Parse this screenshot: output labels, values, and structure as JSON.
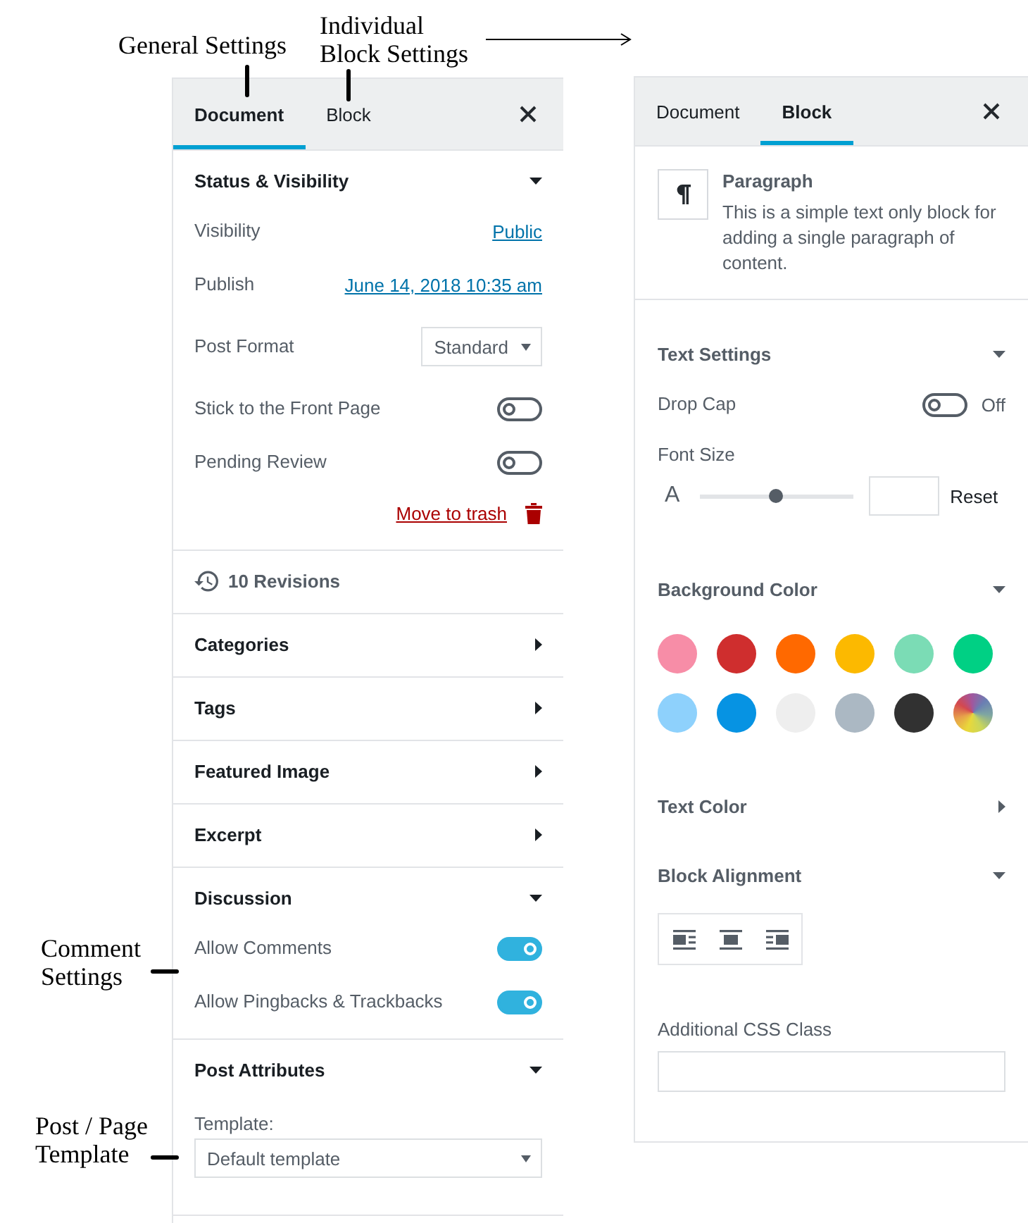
{
  "annotations": [
    {
      "kind": "down",
      "text": "General Settings"
    },
    {
      "kind": "down",
      "text": "Individual Block Settings"
    },
    {
      "kind": "arrow"
    },
    {
      "kind": "side",
      "text": "Comment Settings"
    },
    {
      "kind": "side",
      "text": "Post / Page Template"
    }
  ],
  "document_panel": {
    "tabs": [
      {
        "label": "Document",
        "selected": true
      },
      {
        "label": "Block",
        "selected": false
      }
    ],
    "sections": [
      {
        "kind": "panel",
        "title": "Status & Visibility",
        "expanded": true,
        "rows": [
          {
            "kind": "link",
            "label": "Visibility",
            "value": "Public"
          },
          {
            "kind": "link",
            "label": "Publish",
            "value": "June 14, 2018 10:35 am"
          },
          {
            "kind": "select",
            "label": "Post Format",
            "value": "Standard"
          },
          {
            "kind": "toggle",
            "label": "Stick to the Front Page",
            "on": false
          },
          {
            "kind": "toggle",
            "label": "Pending Review",
            "on": false
          },
          {
            "kind": "trash",
            "label": "Move to trash"
          }
        ]
      },
      {
        "kind": "revisions",
        "title": "10 Revisions"
      },
      {
        "kind": "panel",
        "title": "Categories",
        "expanded": false
      },
      {
        "kind": "panel",
        "title": "Tags",
        "expanded": false
      },
      {
        "kind": "panel",
        "title": "Featured Image",
        "expanded": false
      },
      {
        "kind": "panel",
        "title": "Excerpt",
        "expanded": false
      },
      {
        "kind": "panel",
        "title": "Discussion",
        "expanded": true,
        "rows": [
          {
            "kind": "toggle",
            "label": "Allow Comments",
            "on": true
          },
          {
            "kind": "toggle",
            "label": "Allow Pingbacks & Trackbacks",
            "on": true
          }
        ]
      },
      {
        "kind": "panel",
        "title": "Post Attributes",
        "expanded": true,
        "rows": [
          {
            "kind": "select_block",
            "label": "Template:",
            "value": "Default template"
          }
        ]
      }
    ]
  },
  "block_panel": {
    "tabs": [
      {
        "label": "Document",
        "selected": false
      },
      {
        "label": "Block",
        "selected": true
      }
    ],
    "block_card": {
      "title": "Paragraph",
      "description": "This is a simple text only block for adding a single paragraph of content."
    },
    "sections": [
      {
        "kind": "panel",
        "title": "Text Settings",
        "expanded": true,
        "rows": [
          {
            "kind": "toggle",
            "label": "Drop Cap",
            "on": false,
            "status": "Off"
          },
          {
            "kind": "font_size",
            "label": "Font Size",
            "sample": "A",
            "level": 0.5,
            "reset": "Reset"
          }
        ]
      },
      {
        "kind": "panel",
        "title": "Background Color",
        "expanded": true,
        "rows": [
          {
            "kind": "palette",
            "swatches": [
              {
                "kind": "color",
                "color": "#f78da7"
              },
              {
                "kind": "color",
                "color": "#cf2e2e"
              },
              {
                "kind": "color",
                "color": "#ff6900"
              },
              {
                "kind": "color",
                "color": "#fcb900"
              },
              {
                "kind": "color",
                "color": "#7bdcb5"
              },
              {
                "kind": "color",
                "color": "#00d084"
              },
              {
                "kind": "color",
                "color": "#8ed1fc"
              },
              {
                "kind": "color",
                "color": "#0693e3"
              },
              {
                "kind": "color",
                "color": "#eeeeee"
              },
              {
                "kind": "color",
                "color": "#abb8c3"
              },
              {
                "kind": "color",
                "color": "#313131"
              },
              {
                "kind": "custom"
              }
            ]
          }
        ]
      },
      {
        "kind": "panel",
        "title": "Text Color",
        "expanded": false
      },
      {
        "kind": "panel",
        "title": "Block Alignment",
        "expanded": true,
        "rows": [
          {
            "kind": "alignment"
          }
        ]
      },
      {
        "kind": "plain",
        "rows": [
          {
            "kind": "text_input",
            "label": "Additional CSS Class"
          }
        ]
      }
    ]
  }
}
